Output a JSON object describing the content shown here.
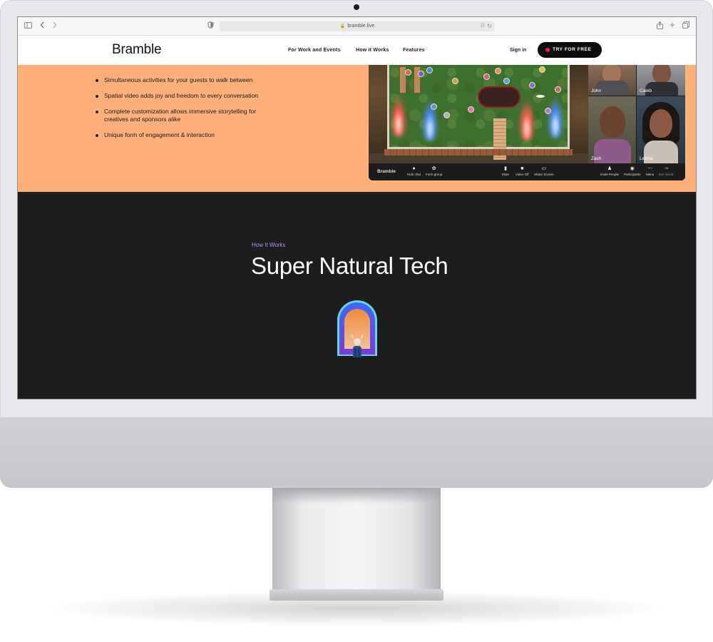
{
  "browser": {
    "url": "bramble.live",
    "icons": [
      "sidebar-icon",
      "back-icon",
      "forward-icon",
      "shield-icon",
      "lock-icon",
      "translate-icon",
      "reload-icon",
      "share-icon",
      "new-tab-icon",
      "tabs-overview-icon"
    ]
  },
  "nav": {
    "logo": "Bramble",
    "links": [
      "For Work and Events",
      "How it Works",
      "Features"
    ],
    "signin": "Sign in",
    "cta": "TRY FOR FREE"
  },
  "features": {
    "bullets": [
      "Simultaneous activities for your guests to walk between",
      "Spatial video adds joy and freedom to every conversation",
      "Complete customization allows immersive storytelling for creatives and sponsors alike",
      "Unique form of engagement & interaction"
    ]
  },
  "app_preview": {
    "brand": "Bramble",
    "participants": [
      "John",
      "Caleb",
      "Zach",
      "Leticia"
    ],
    "toolbar": {
      "hide_chat": "Hide chat",
      "form_group": "Form group",
      "mute": "Mute",
      "video_off": "Video Off",
      "share_screen": "Share Screen",
      "invite_people": "Invite People",
      "participants": "Participants",
      "menu": "Menu",
      "exit_world": "Exit World"
    }
  },
  "how_it_works": {
    "eyebrow": "How It Works",
    "title": "Super Natural Tech"
  },
  "colors": {
    "accent_orange": "#ffb07a",
    "dark_bg": "#1d1d1e",
    "eyebrow_purple": "#b18cf5",
    "cta_dot": "#e6224b"
  }
}
